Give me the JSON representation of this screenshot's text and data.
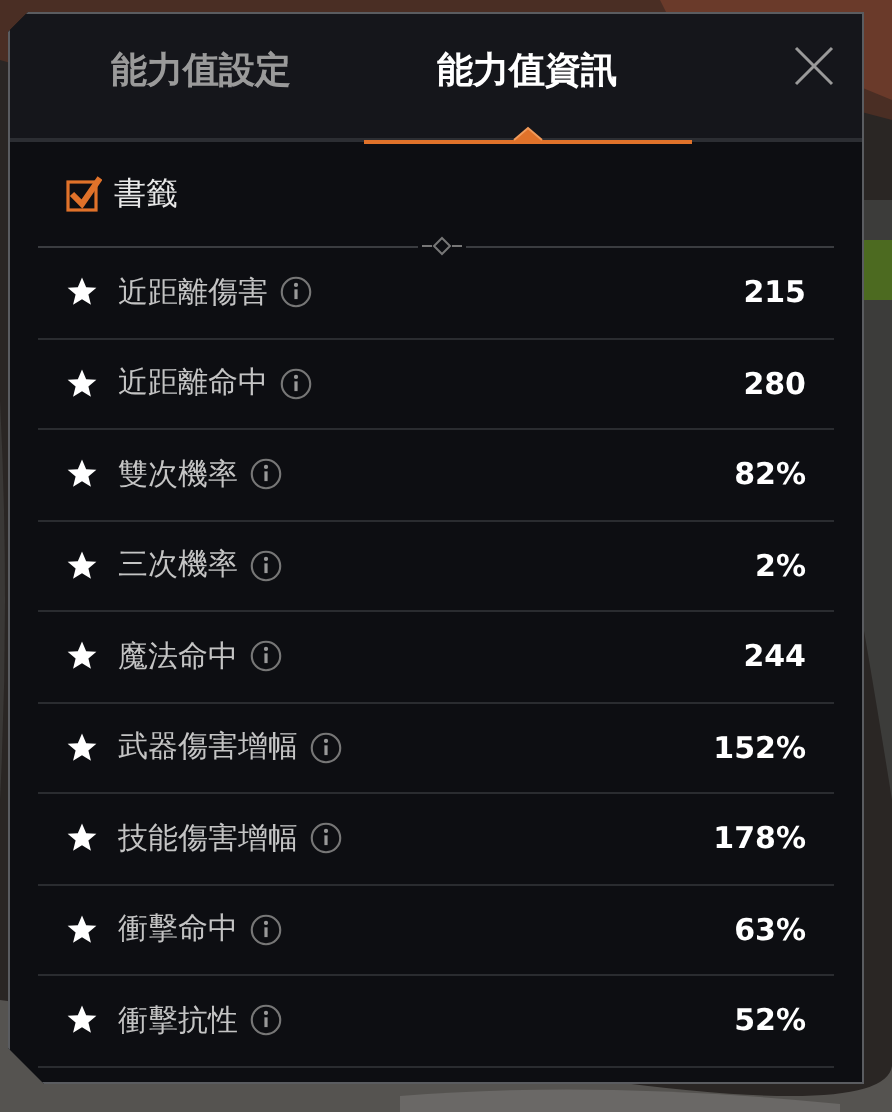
{
  "tabs": [
    {
      "label": "能力值設定",
      "selected": false
    },
    {
      "label": "能力值資訊",
      "selected": true
    }
  ],
  "bookmark": {
    "label": "書籤",
    "checked": true
  },
  "stats": [
    {
      "name": "近距離傷害",
      "value": "215"
    },
    {
      "name": "近距離命中",
      "value": "280"
    },
    {
      "name": "雙次機率",
      "value": "82%"
    },
    {
      "name": "三次機率",
      "value": "2%"
    },
    {
      "name": "魔法命中",
      "value": "244"
    },
    {
      "name": "武器傷害增幅",
      "value": "152%"
    },
    {
      "name": "技能傷害增幅",
      "value": "178%"
    },
    {
      "name": "衝擊命中",
      "value": "63%"
    },
    {
      "name": "衝擊抗性",
      "value": "52%"
    }
  ]
}
